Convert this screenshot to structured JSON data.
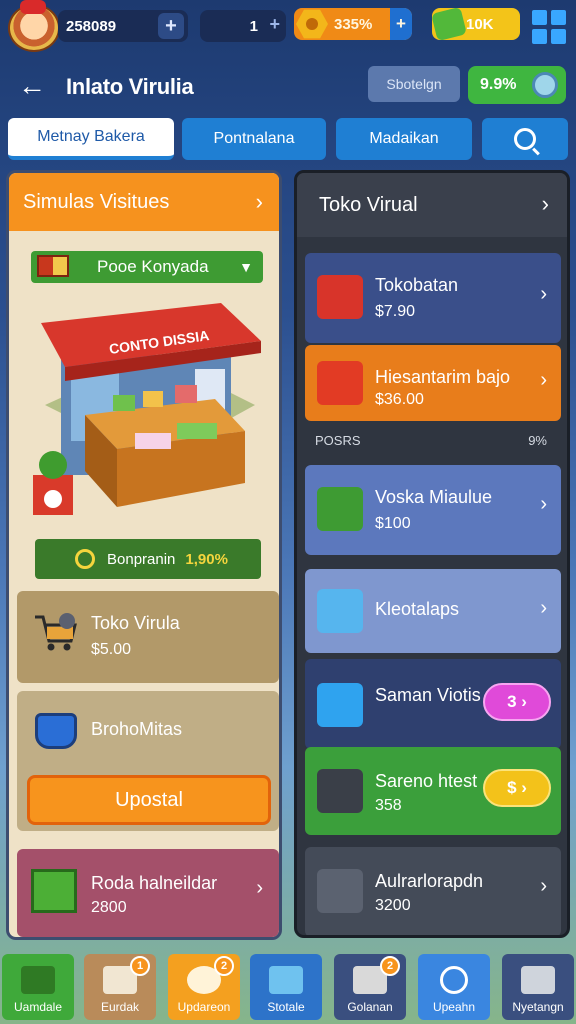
{
  "topbar": {
    "coins": "258089",
    "level": "1",
    "gems": "335%",
    "cash": "10K"
  },
  "header": {
    "title": "Inlato Virulia",
    "secondary_button": "Sbotelgn",
    "balance": "9.9%"
  },
  "tabs": [
    {
      "label": "Metnay Bakera"
    },
    {
      "label": "Pontnalana"
    },
    {
      "label": "Madaikan"
    }
  ],
  "left_panel": {
    "title": "Simulas Visitues",
    "dropdown_value": "Pooe Konyada",
    "sign_text": "CONTO DISSIA",
    "promo_label": "Bonpranin",
    "promo_value": "1,90%",
    "card1": {
      "title": "Toko Virula",
      "price": "$5.00"
    },
    "card2": {
      "title": "BrohoMitas",
      "button": "Upostal"
    },
    "card3": {
      "title": "Roda halneildar",
      "price": "2800"
    }
  },
  "right_panel": {
    "title": "Toko Virual",
    "divider_left": "POSRS",
    "divider_right": "9%",
    "items": [
      {
        "title": "Tokobatan",
        "price": "$7.90"
      },
      {
        "title": "Hiesantarim bajo",
        "price": "$36.00"
      },
      {
        "title": "Voska Miaulue",
        "price": "$100"
      },
      {
        "title": "Kleotalaps",
        "price": ""
      },
      {
        "title": "Saman Viotis",
        "price": "",
        "button": "3"
      },
      {
        "title": "Sareno htest",
        "price": "358",
        "button": "$"
      },
      {
        "title": "Aulrarlorapdn",
        "price": "3200"
      }
    ]
  },
  "bottom_nav": [
    {
      "label": "Uamdale",
      "color": "#3fa93a"
    },
    {
      "label": "Eurdak",
      "color": "#b98b5a",
      "badge": "1"
    },
    {
      "label": "Updareon",
      "color": "#f4a01f",
      "badge": "2"
    },
    {
      "label": "Stotale",
      "color": "#2d73c9"
    },
    {
      "label": "Golanan",
      "color": "#3a4f7f",
      "badge": "2"
    },
    {
      "label": "Upeahn",
      "color": "#3a86e0"
    },
    {
      "label": "Nyetangn",
      "color": "#3a4f7f"
    }
  ]
}
